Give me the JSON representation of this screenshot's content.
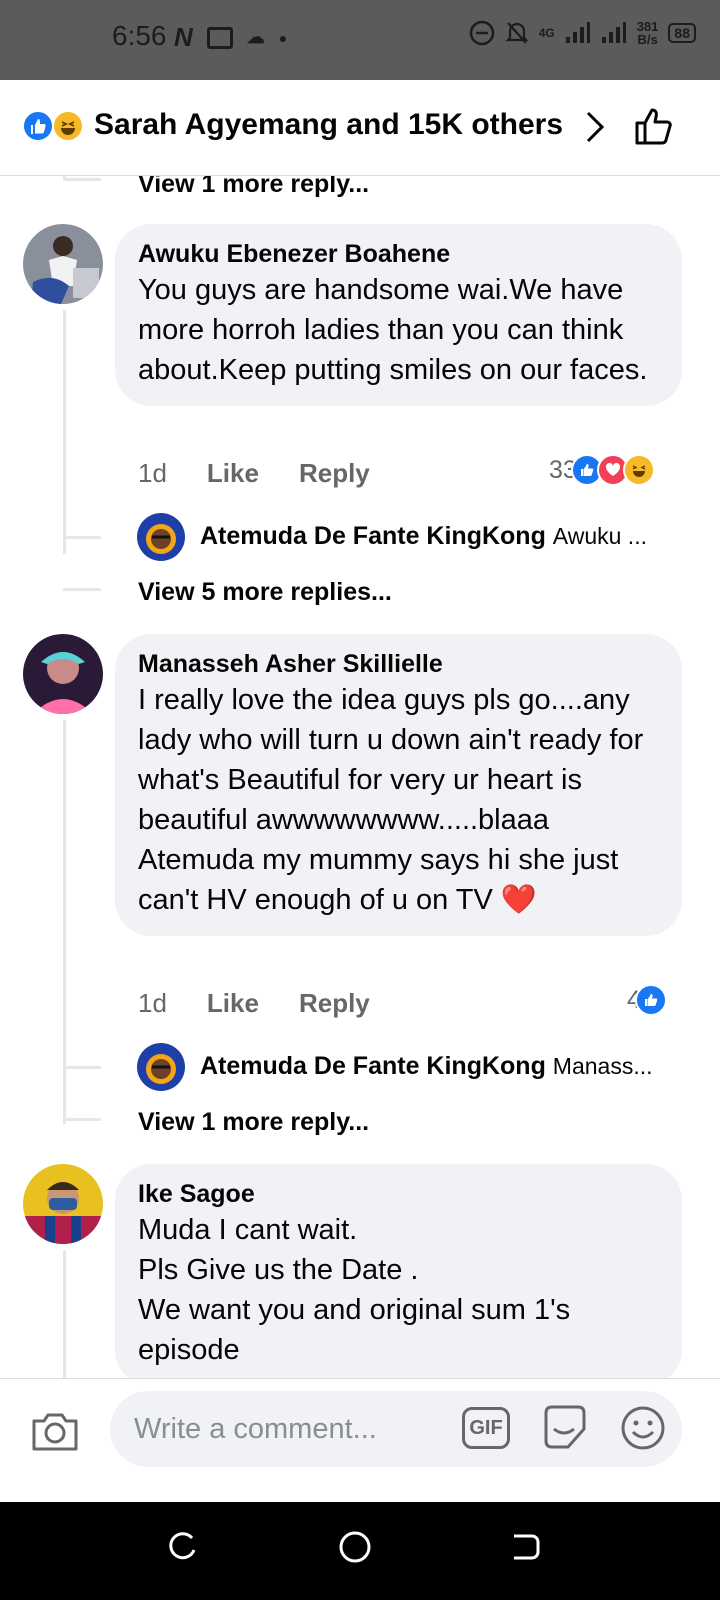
{
  "status_bar": {
    "time": "6:56",
    "network": "4G",
    "speed_value": "381",
    "speed_unit": "B/s",
    "battery": "88"
  },
  "header": {
    "title": "Sarah Agyemang and 15K others",
    "reaction_icons": [
      "like-icon",
      "haha-icon"
    ]
  },
  "thread": {
    "top_view_more": "View 1 more reply...",
    "comments": [
      {
        "author": "Awuku Ebenezer Boahene",
        "text": "You guys are handsome wai.We have more horroh ladies than you can think about.Keep putting smiles on our faces.",
        "time": "1d",
        "like_label": "Like",
        "reply_label": "Reply",
        "reaction_count": "33",
        "reactions": [
          "like-icon",
          "love-icon",
          "haha-icon"
        ],
        "reply_preview": {
          "author": "Atemuda De Fante KingKong",
          "snippet": "Awuku ..."
        },
        "view_more": "View 5 more replies..."
      },
      {
        "author": "Manasseh Asher Skillielle",
        "text": "I really love the idea guys pls go....any lady who will turn u down ain't ready for what's Beautiful for very ur heart is beautiful awwwwwwww.....blaaa Atemuda my mummy says hi she just can't HV enough of u on TV ❤️",
        "time": "1d",
        "like_label": "Like",
        "reply_label": "Reply",
        "reaction_count": "4",
        "reactions": [
          "like-icon"
        ],
        "reply_preview": {
          "author": "Atemuda De Fante KingKong",
          "snippet": "Manass..."
        },
        "view_more": "View 1 more reply..."
      },
      {
        "author": "Ike Sagoe",
        "text": "Muda I cant wait.\nPls Give us  the Date .\nWe want you and original sum 1's episode"
      }
    ]
  },
  "composer": {
    "placeholder": "Write a comment...",
    "gif_label": "GIF"
  },
  "colors": {
    "like_blue": "#1877f2",
    "love_red": "#f33e58",
    "haha_yellow": "#f7b928",
    "bubble_bg": "#f0f2f5",
    "secondary_text": "#65676b"
  }
}
